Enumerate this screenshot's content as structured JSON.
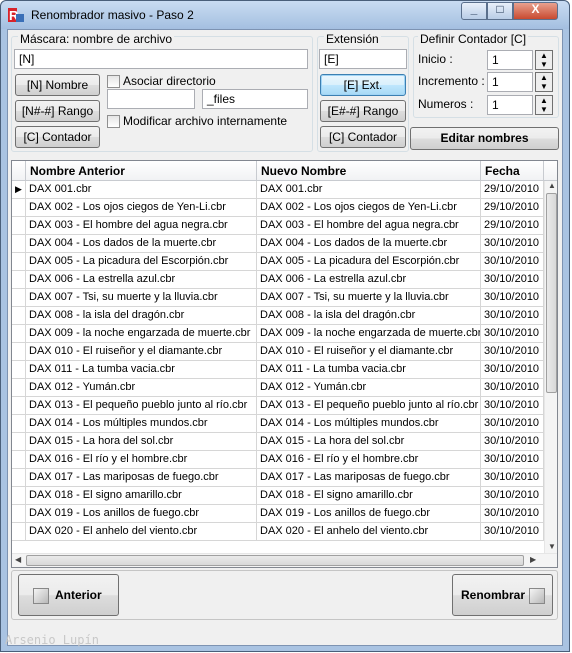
{
  "window": {
    "title": "Renombrador masivo - Paso 2",
    "icon": "app-icon",
    "controls": {
      "minimize": "_",
      "maximize": "□",
      "close": "X"
    }
  },
  "mask": {
    "group_label": "Máscara: nombre de archivo",
    "value": "[N]",
    "buttons": {
      "name": "[N]  Nombre",
      "range": "[N#-#]  Rango",
      "counter": "[C]  Contador"
    },
    "associate_dir_label": "Asociar directorio",
    "associate_dir_checked": false,
    "dir_field_left": "",
    "dir_field_right": "_files",
    "modify_internal_label": "Modificar archivo internamente",
    "modify_internal_checked": false
  },
  "extension": {
    "group_label": "Extensión",
    "value": "[E]",
    "buttons": {
      "ext": "[E]  Ext.",
      "range": "[E#-#]  Rango",
      "counter": "[C]  Contador"
    }
  },
  "counter": {
    "group_label": "Definir Contador [C]",
    "start_label": "Inicio :",
    "start_value": "1",
    "increment_label": "Incremento :",
    "increment_value": "1",
    "numbers_label": "Numeros :",
    "numbers_value": "1"
  },
  "edit_names_button": "Editar nombres",
  "table": {
    "headers": [
      "Nombre Anterior",
      "Nuevo Nombre",
      "Fecha"
    ],
    "selected_indicator": "▶",
    "rows": [
      [
        "DAX 001.cbr",
        "DAX 001.cbr",
        "29/10/2010"
      ],
      [
        "DAX 002 - Los ojos ciegos de Yen-Li.cbr",
        "DAX 002 - Los ojos ciegos de Yen-Li.cbr",
        "29/10/2010"
      ],
      [
        "DAX 003 - El hombre del agua negra.cbr",
        "DAX 003 - El hombre del agua negra.cbr",
        "29/10/2010"
      ],
      [
        "DAX 004 - Los dados de la muerte.cbr",
        "DAX 004 - Los dados de la muerte.cbr",
        "30/10/2010"
      ],
      [
        "DAX 005 - La picadura del Escorpión.cbr",
        "DAX 005 - La picadura del Escorpión.cbr",
        "30/10/2010"
      ],
      [
        "DAX 006 - La estrella azul.cbr",
        "DAX 006 - La estrella azul.cbr",
        "30/10/2010"
      ],
      [
        "DAX 007 - Tsi, su muerte y la lluvia.cbr",
        "DAX 007 - Tsi, su muerte y la lluvia.cbr",
        "30/10/2010"
      ],
      [
        "DAX 008 - la isla del dragón.cbr",
        "DAX 008 - la isla del dragón.cbr",
        "30/10/2010"
      ],
      [
        "DAX 009 - la noche engarzada de muerte.cbr",
        "DAX 009 - la noche engarzada de muerte.cbr",
        "30/10/2010"
      ],
      [
        "DAX 010 - El ruiseñor y el diamante.cbr",
        "DAX 010 - El ruiseñor y el diamante.cbr",
        "30/10/2010"
      ],
      [
        "DAX 011 - La tumba vacia.cbr",
        "DAX 011 - La tumba vacia.cbr",
        "30/10/2010"
      ],
      [
        "DAX 012 - Yumán.cbr",
        "DAX 012 - Yumán.cbr",
        "30/10/2010"
      ],
      [
        "DAX 013 - El pequeño pueblo junto al río.cbr",
        "DAX 013 - El pequeño pueblo junto al río.cbr",
        "30/10/2010"
      ],
      [
        "DAX 014 - Los múltiples mundos.cbr",
        "DAX 014 - Los múltiples mundos.cbr",
        "30/10/2010"
      ],
      [
        "DAX 015 - La hora del sol.cbr",
        "DAX 015 - La hora del sol.cbr",
        "30/10/2010"
      ],
      [
        "DAX 016 - El río y el hombre.cbr",
        "DAX 016 - El río y el hombre.cbr",
        "30/10/2010"
      ],
      [
        "DAX 017 - Las mariposas de fuego.cbr",
        "DAX 017 - Las mariposas de fuego.cbr",
        "30/10/2010"
      ],
      [
        "DAX 018 - El signo amarillo.cbr",
        "DAX 018 - El signo amarillo.cbr",
        "30/10/2010"
      ],
      [
        "DAX 019 - Los anillos de fuego.cbr",
        "DAX 019 - Los anillos de fuego.cbr",
        "30/10/2010"
      ],
      [
        "DAX 020 - El anhelo del viento.cbr",
        "DAX 020 - El anhelo del viento.cbr",
        "30/10/2010"
      ]
    ]
  },
  "nav": {
    "back_label": "Anterior",
    "rename_label": "Renombrar"
  },
  "watermark": "Arsenio Lupín",
  "colors": {
    "titlebar": "#a4bfe0",
    "client": "#f0f0f0",
    "focus_button": "#a7d9f5",
    "grid_border": "#828790"
  }
}
